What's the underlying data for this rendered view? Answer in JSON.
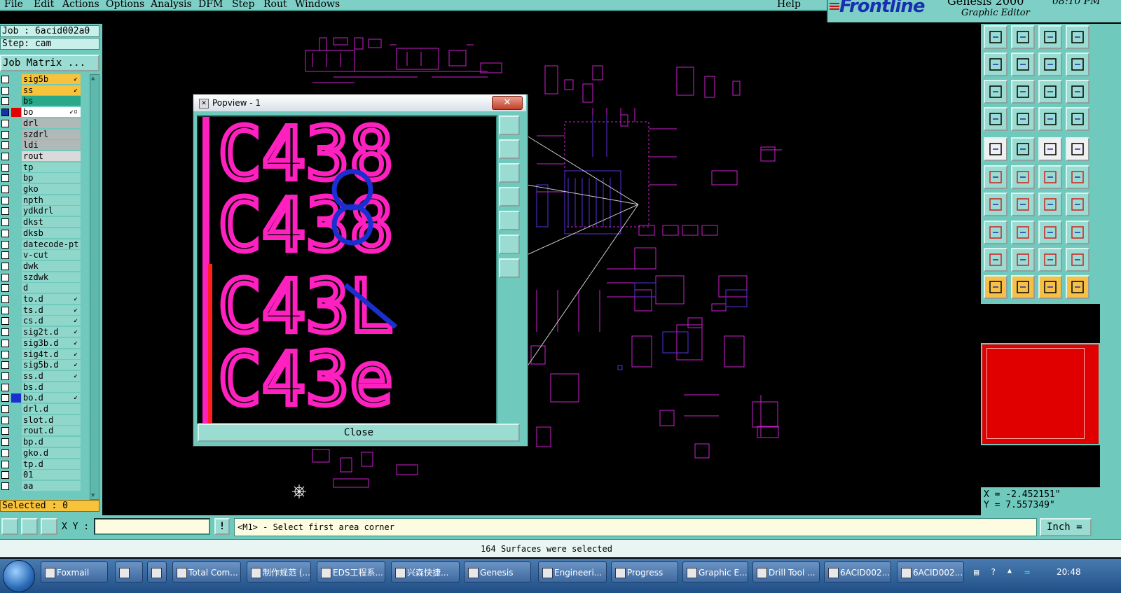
{
  "menu": {
    "items": [
      "File",
      "Edit",
      "Actions",
      "Options",
      "Analysis",
      "DFM",
      "Step",
      "Rout",
      "Windows"
    ],
    "help": "Help"
  },
  "brand": {
    "logo": "Frontline",
    "product": "Genesis 2000",
    "subtitle": "Graphic Editor",
    "time": "08:10 PM"
  },
  "left": {
    "job": "Job : 6acid002a0",
    "step": "Step: cam",
    "job_matrix": "Job Matrix ...",
    "selected": "Selected : 0",
    "layers": [
      {
        "name": "sig5b",
        "color": "#f7c23c",
        "checked": false,
        "mark": "↙"
      },
      {
        "name": "ss",
        "color": "#f7c23c",
        "checked": false,
        "mark": "↙"
      },
      {
        "name": "bs",
        "color": "#2aa98a",
        "checked": false,
        "mark": ""
      },
      {
        "name": "bo",
        "color": "#ffffff",
        "checked": true,
        "mark": "↙▫",
        "swatch": "#e00000"
      },
      {
        "name": "drl",
        "color": "#b0b8b8",
        "checked": false,
        "mark": ""
      },
      {
        "name": "szdrl",
        "color": "#b0b8b8",
        "checked": false,
        "mark": ""
      },
      {
        "name": "ldi",
        "color": "#b0b8b8",
        "checked": false,
        "mark": ""
      },
      {
        "name": "rout",
        "color": "#dadada",
        "checked": false,
        "mark": ""
      },
      {
        "name": "tp",
        "color": "#8fd6cb",
        "checked": false,
        "mark": ""
      },
      {
        "name": "bp",
        "color": "#8fd6cb",
        "checked": false,
        "mark": ""
      },
      {
        "name": "gko",
        "color": "#8fd6cb",
        "checked": false,
        "mark": ""
      },
      {
        "name": "npth",
        "color": "#8fd6cb",
        "checked": false,
        "mark": ""
      },
      {
        "name": "ydkdrl",
        "color": "#8fd6cb",
        "checked": false,
        "mark": ""
      },
      {
        "name": "dkst",
        "color": "#8fd6cb",
        "checked": false,
        "mark": ""
      },
      {
        "name": "dksb",
        "color": "#8fd6cb",
        "checked": false,
        "mark": ""
      },
      {
        "name": "datecode-pt",
        "color": "#8fd6cb",
        "checked": false,
        "mark": ""
      },
      {
        "name": "v-cut",
        "color": "#8fd6cb",
        "checked": false,
        "mark": ""
      },
      {
        "name": "dwk",
        "color": "#8fd6cb",
        "checked": false,
        "mark": ""
      },
      {
        "name": "szdwk",
        "color": "#8fd6cb",
        "checked": false,
        "mark": ""
      },
      {
        "name": "d",
        "color": "#8fd6cb",
        "checked": false,
        "mark": ""
      },
      {
        "name": "to.d",
        "color": "#8fd6cb",
        "checked": false,
        "mark": "↙"
      },
      {
        "name": "ts.d",
        "color": "#8fd6cb",
        "checked": false,
        "mark": "↙"
      },
      {
        "name": "cs.d",
        "color": "#8fd6cb",
        "checked": false,
        "mark": "↙"
      },
      {
        "name": "sig2t.d",
        "color": "#8fd6cb",
        "checked": false,
        "mark": "↙"
      },
      {
        "name": "sig3b.d",
        "color": "#8fd6cb",
        "checked": false,
        "mark": "↙"
      },
      {
        "name": "sig4t.d",
        "color": "#8fd6cb",
        "checked": false,
        "mark": "↙"
      },
      {
        "name": "sig5b.d",
        "color": "#8fd6cb",
        "checked": false,
        "mark": "↙"
      },
      {
        "name": "ss.d",
        "color": "#8fd6cb",
        "checked": false,
        "mark": "↙"
      },
      {
        "name": "bs.d",
        "color": "#8fd6cb",
        "checked": false,
        "mark": ""
      },
      {
        "name": "bo.d",
        "color": "#8fd6cb",
        "checked": false,
        "mark": "↙",
        "swatch": "#1a2fd0"
      },
      {
        "name": "drl.d",
        "color": "#8fd6cb",
        "checked": false,
        "mark": ""
      },
      {
        "name": "slot.d",
        "color": "#8fd6cb",
        "checked": false,
        "mark": ""
      },
      {
        "name": "rout.d",
        "color": "#8fd6cb",
        "checked": false,
        "mark": ""
      },
      {
        "name": "bp.d",
        "color": "#8fd6cb",
        "checked": false,
        "mark": ""
      },
      {
        "name": "gko.d",
        "color": "#8fd6cb",
        "checked": false,
        "mark": ""
      },
      {
        "name": "tp.d",
        "color": "#8fd6cb",
        "checked": false,
        "mark": ""
      },
      {
        "name": "01",
        "color": "#8fd6cb",
        "checked": false,
        "mark": ""
      },
      {
        "name": "aa",
        "color": "#8fd6cb",
        "checked": false,
        "mark": ""
      }
    ]
  },
  "popview": {
    "title": "Popview - 1",
    "close_x": "✕",
    "close_label": "Close",
    "glyphs": [
      "C438",
      "C438",
      "C43L",
      "C43e"
    ]
  },
  "coords": {
    "x": "X = -2.452151\"",
    "y": "Y = 7.557349\""
  },
  "command": {
    "xy_label": "X Y :",
    "xy_value": "",
    "warn": "!",
    "prompt": "<M1> - Select first area corner",
    "units": "Inch ="
  },
  "status": "164 Surfaces were selected",
  "taskbar": {
    "items": [
      "Foxmail",
      "",
      "",
      "Total Com...",
      "制作规范 (...",
      "EDS工程系...",
      "兴森快捷...",
      "Genesis",
      "Engineeri...",
      "Progress",
      "Graphic E...",
      "Drill Tool ...",
      "6ACID002...",
      "6ACID002..."
    ],
    "clock": "20:48"
  },
  "colors": {
    "panel": "#6fc9bd",
    "magenta": "#ff20c0",
    "blue": "#1a2fd0",
    "selected_bar": "#f7c23c",
    "overview": "#e00000"
  }
}
